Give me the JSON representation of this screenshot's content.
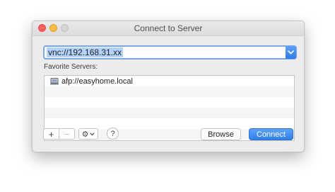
{
  "window": {
    "title": "Connect to Server"
  },
  "address": {
    "value": "vnc://192.168.31.xx"
  },
  "favorites": {
    "label": "Favorite Servers:",
    "items": [
      {
        "label": "afp://easyhome.local",
        "icon": "server-icon"
      }
    ]
  },
  "toolbar": {
    "add_label": "+",
    "remove_label": "−",
    "gear_label": "⚙",
    "help_label": "?"
  },
  "buttons": {
    "browse_label": "Browse",
    "connect_label": "Connect"
  },
  "colors": {
    "accent": "#2f7fec",
    "selection": "#b3d3fd"
  }
}
